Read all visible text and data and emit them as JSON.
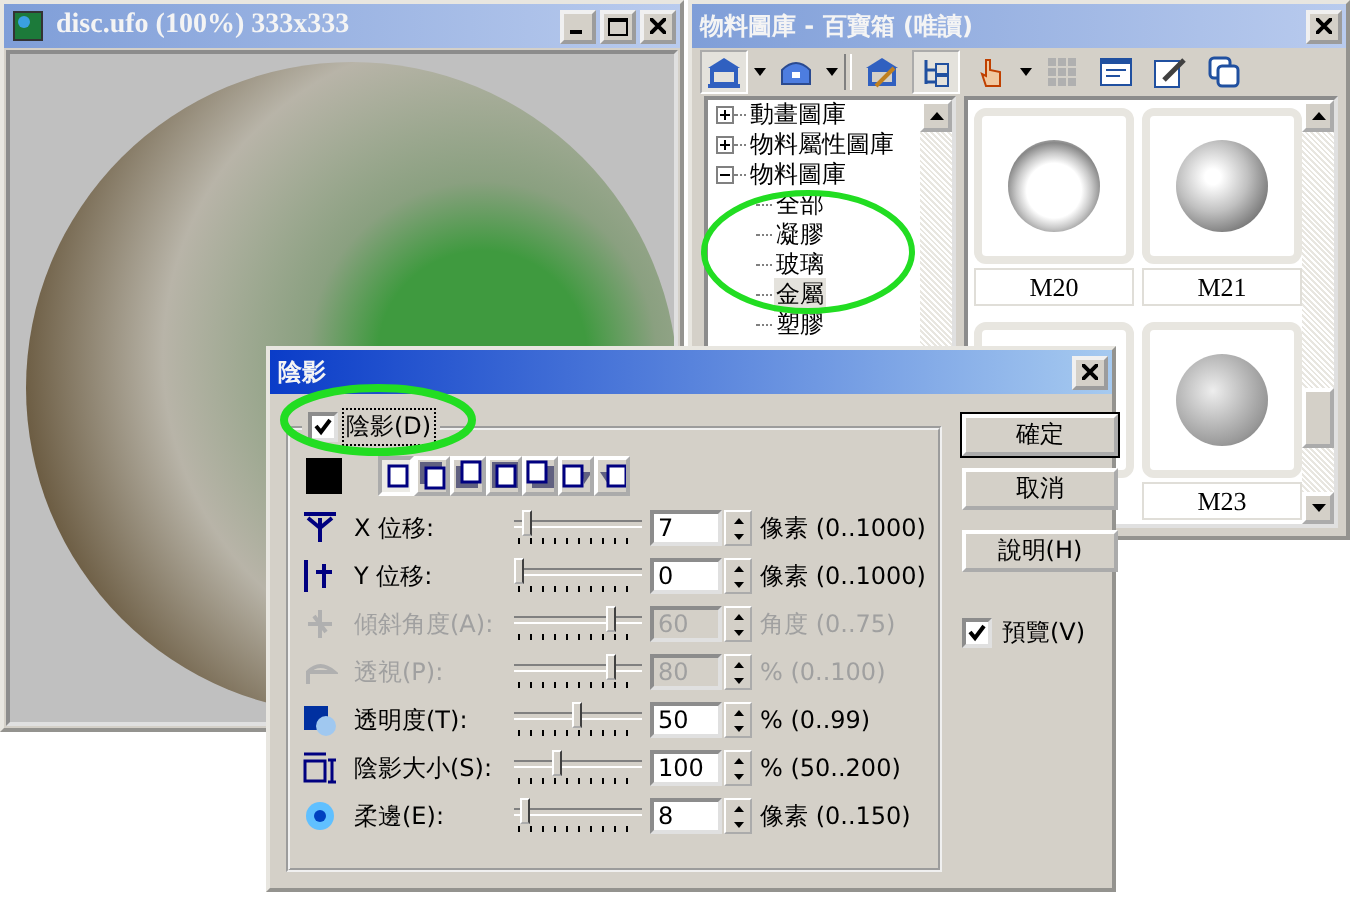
{
  "image_window": {
    "title": "disc.ufo (100%) 333x333"
  },
  "library_window": {
    "title": "物料圖庫 - 百寶箱 (唯讀)",
    "tree": [
      {
        "label": "動畫圖庫",
        "expanded": false,
        "selected": false
      },
      {
        "label": "物料屬性圖庫",
        "expanded": false,
        "selected": false
      },
      {
        "label": "物料圖庫",
        "expanded": true,
        "selected": false,
        "children": [
          {
            "label": "全部",
            "selected": false
          },
          {
            "label": "凝膠",
            "selected": false
          },
          {
            "label": "玻璃",
            "selected": false
          },
          {
            "label": "金屬",
            "selected": true
          },
          {
            "label": "塑膠",
            "selected": false
          }
        ]
      }
    ],
    "thumbnails": [
      {
        "label": "M20"
      },
      {
        "label": "M21"
      },
      {
        "label": "M23"
      }
    ]
  },
  "shadow_dialog": {
    "title": "陰影",
    "shadow_toggle": {
      "label": "陰影(D)",
      "checked": true
    },
    "shadow_styles": [
      {
        "selected": true
      },
      {
        "selected": false
      },
      {
        "selected": false
      },
      {
        "selected": false
      },
      {
        "selected": false
      },
      {
        "selected": false
      },
      {
        "selected": false
      }
    ],
    "settings": [
      {
        "kind": "x_offset",
        "label": "X 位移:",
        "value": "7",
        "unit": "像素 (0..1000)",
        "level": 0.07,
        "disabled": false
      },
      {
        "kind": "y_offset",
        "label": "Y 位移:",
        "value": "0",
        "unit": "像素 (0..1000)",
        "level": 0.0,
        "disabled": false
      },
      {
        "kind": "skew",
        "label": "傾斜角度(A):",
        "value": "60",
        "unit": "角度 (0..75)",
        "level": 0.8,
        "disabled": true
      },
      {
        "kind": "perspective",
        "label": "透視(P):",
        "value": "80",
        "unit": "% (0..100)",
        "level": 0.8,
        "disabled": true
      },
      {
        "kind": "transparency",
        "label": "透明度(T):",
        "value": "50",
        "unit": "% (0..99)",
        "level": 0.5,
        "disabled": false
      },
      {
        "kind": "size",
        "label": "陰影大小(S):",
        "value": "100",
        "unit": "% (50..200)",
        "level": 0.33,
        "disabled": false
      },
      {
        "kind": "feather",
        "label": "柔邊(E):",
        "value": "8",
        "unit": "像素 (0..150)",
        "level": 0.05,
        "disabled": false
      }
    ],
    "buttons": [
      {
        "label": "確定",
        "default": true
      },
      {
        "label": "取消",
        "default": false
      },
      {
        "label": "說明(H)",
        "default": false
      }
    ],
    "preview": {
      "label": "預覽(V)",
      "checked": true
    }
  }
}
